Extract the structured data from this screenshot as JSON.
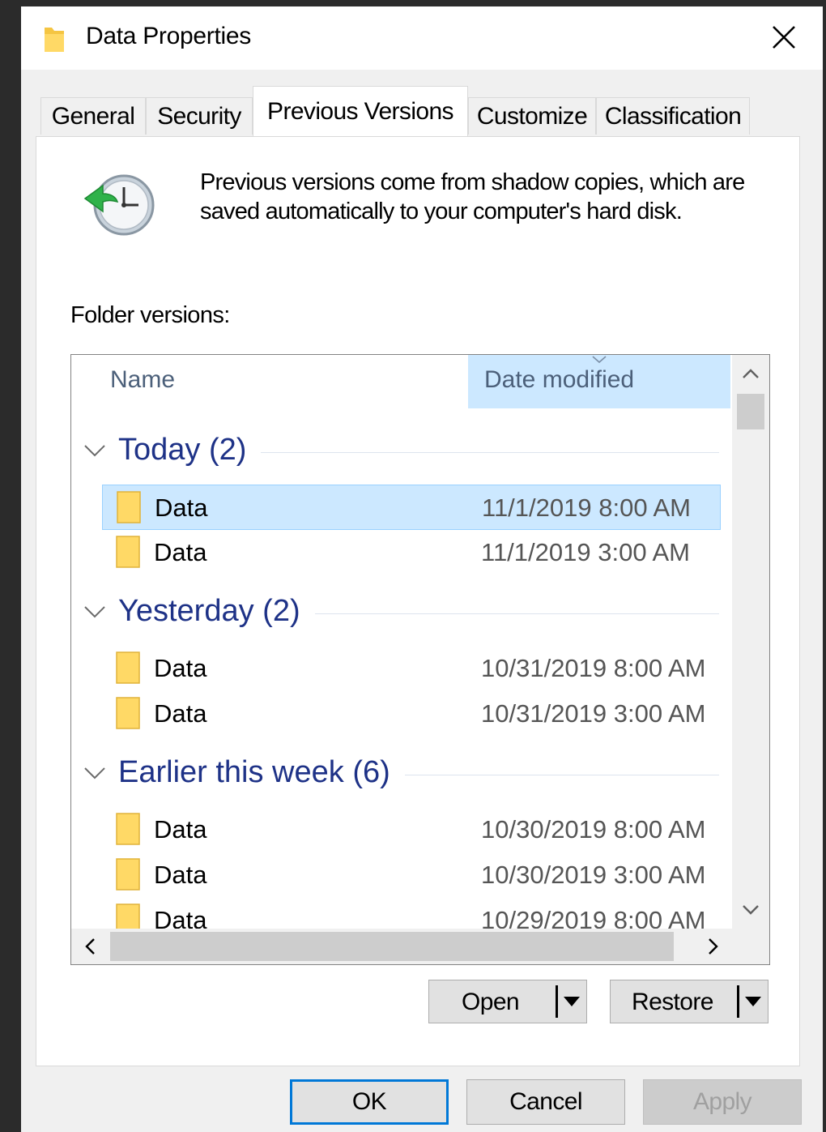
{
  "window": {
    "title": "Data Properties",
    "close_icon": "close-icon",
    "title_icon": "folder-icon"
  },
  "tabs": [
    {
      "label": "General"
    },
    {
      "label": "Security"
    },
    {
      "label": "Previous Versions",
      "active": true
    },
    {
      "label": "Customize"
    },
    {
      "label": "Classification"
    }
  ],
  "panel": {
    "icon": "restore-clock-icon",
    "description": "Previous versions come from shadow copies, which are saved automatically to your computer's hard disk.",
    "folder_versions_label": "Folder versions:"
  },
  "list": {
    "columns": {
      "name": "Name",
      "date": "Date modified"
    },
    "groups": [
      {
        "title": "Today (2)",
        "items": [
          {
            "name": "Data",
            "date": "11/1/2019 8:00 AM",
            "selected": true
          },
          {
            "name": "Data",
            "date": "11/1/2019 3:00 AM"
          }
        ]
      },
      {
        "title": "Yesterday (2)",
        "items": [
          {
            "name": "Data",
            "date": "10/31/2019 8:00 AM"
          },
          {
            "name": "Data",
            "date": "10/31/2019 3:00 AM"
          }
        ]
      },
      {
        "title": "Earlier this week (6)",
        "items": [
          {
            "name": "Data",
            "date": "10/30/2019 8:00 AM"
          },
          {
            "name": "Data",
            "date": "10/30/2019 3:00 AM"
          },
          {
            "name": "Data",
            "date": "10/29/2019 8:00 AM"
          }
        ]
      }
    ]
  },
  "actions": {
    "open_label": "Open",
    "restore_label": "Restore"
  },
  "footer": {
    "ok_label": "OK",
    "cancel_label": "Cancel",
    "apply_label": "Apply"
  },
  "colors": {
    "group_title": "#1e3287",
    "selection": "#cce8ff",
    "default_button_border": "#0078d7"
  }
}
